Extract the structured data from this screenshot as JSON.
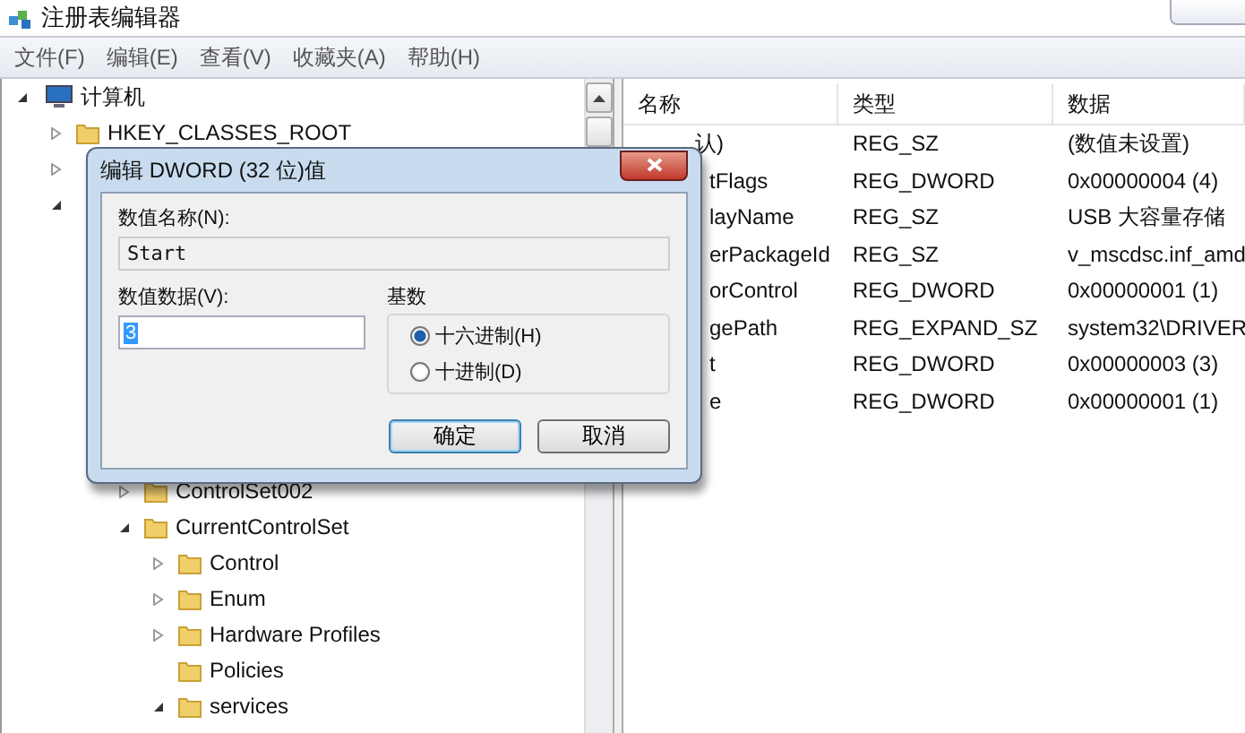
{
  "window": {
    "title": "注册表编辑器"
  },
  "menu": [
    "文件(F)",
    "编辑(E)",
    "查看(V)",
    "收藏夹(A)",
    "帮助(H)"
  ],
  "tree": [
    {
      "label": "计算机",
      "kind": "computer",
      "expanded": true,
      "children": [
        {
          "label": "HKEY_CLASSES_ROOT",
          "kind": "folder",
          "expanded": false
        },
        {
          "expanded": false
        },
        {
          "expanded": true,
          "children": [
            {
              "children": [
                {
                  "label": "ControlSet002",
                  "kind": "folder",
                  "expanded": false
                },
                {
                  "label": "CurrentControlSet",
                  "kind": "folder",
                  "expanded": true,
                  "children": [
                    {
                      "label": "Control",
                      "kind": "folder",
                      "expanded": false
                    },
                    {
                      "label": "Enum",
                      "kind": "folder",
                      "expanded": false
                    },
                    {
                      "label": "Hardware Profiles",
                      "kind": "folder",
                      "expanded": false
                    },
                    {
                      "label": "Policies",
                      "kind": "folder"
                    },
                    {
                      "label": "services",
                      "kind": "folder",
                      "expanded": true
                    }
                  ]
                }
              ]
            }
          ]
        }
      ]
    }
  ],
  "list": {
    "columns": [
      "名称",
      "类型",
      "数据"
    ],
    "rows": [
      {
        "name": "认)",
        "type": "REG_SZ",
        "data": "(数值未设置)"
      },
      {
        "name": "tFlags",
        "type": "REG_DWORD",
        "data": "0x00000004 (4)"
      },
      {
        "name": "layName",
        "type": "REG_SZ",
        "data": "USB 大容量存储"
      },
      {
        "name": "erPackageId",
        "type": "REG_SZ",
        "data": "v_mscdsc.inf_amd"
      },
      {
        "name": "orControl",
        "type": "REG_DWORD",
        "data": "0x00000001 (1)"
      },
      {
        "name": "gePath",
        "type": "REG_EXPAND_SZ",
        "data": "system32\\DRIVER"
      },
      {
        "name": "t",
        "type": "REG_DWORD",
        "data": "0x00000003 (3)"
      },
      {
        "name": "e",
        "type": "REG_DWORD",
        "data": "0x00000001 (1)"
      }
    ]
  },
  "dialog": {
    "title": "编辑 DWORD (32 位)值",
    "name_label": "数值名称(N):",
    "name_value": "Start",
    "data_label": "数值数据(V):",
    "data_value": "3",
    "data_highlighted": true,
    "base": {
      "label": "基数",
      "options": [
        {
          "label": "十六进制(H)",
          "selected": true
        },
        {
          "label": "十进制(D)",
          "selected": false
        }
      ]
    },
    "buttons": [
      {
        "label": "确定",
        "default": true
      },
      {
        "label": "取消",
        "default": false
      }
    ]
  }
}
